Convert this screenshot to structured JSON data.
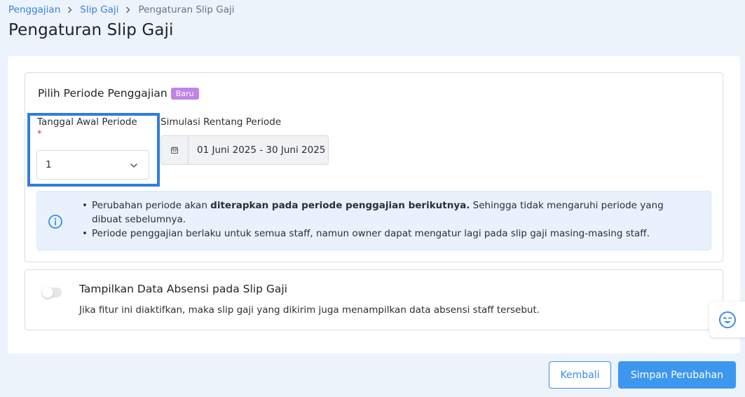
{
  "breadcrumb": {
    "items": [
      "Penggajian",
      "Slip Gaji"
    ],
    "current": "Pengaturan Slip Gaji"
  },
  "page_title": "Pengaturan Slip Gaji",
  "period_section": {
    "title": "Pilih Periode Penggajian",
    "badge": "Baru",
    "start_field": {
      "label": "Tanggal Awal Periode",
      "required_mark": "*",
      "value": "1"
    },
    "range_field": {
      "label": "Simulasi Rentang Periode",
      "value": "01 Juni 2025 - 30 Juni 2025"
    },
    "info": {
      "item1_prefix": "Perubahan periode akan ",
      "item1_bold": "diterapkan pada periode penggajian berikutnya.",
      "item1_suffix": " Sehingga tidak mengaruhi periode yang dibuat sebelumnya.",
      "item2": "Periode penggajian berlaku untuk semua staff, namun owner dapat mengatur lagi pada slip gaji masing-masing staff."
    }
  },
  "absensi_section": {
    "title": "Tampilkan Data Absensi pada Slip Gaji",
    "description": "Jika fitur ini diaktifkan, maka slip gaji yang dikirim juga menampilkan data absensi staff tersebut.",
    "toggle_on": false
  },
  "buttons": {
    "back": "Kembali",
    "save": "Simpan Perubahan"
  },
  "colors": {
    "accent": "#3d97ee",
    "link": "#3b82d6",
    "badge": "#c084e6",
    "highlight": "#2f7de0",
    "info_bg": "#e8f1fc"
  }
}
